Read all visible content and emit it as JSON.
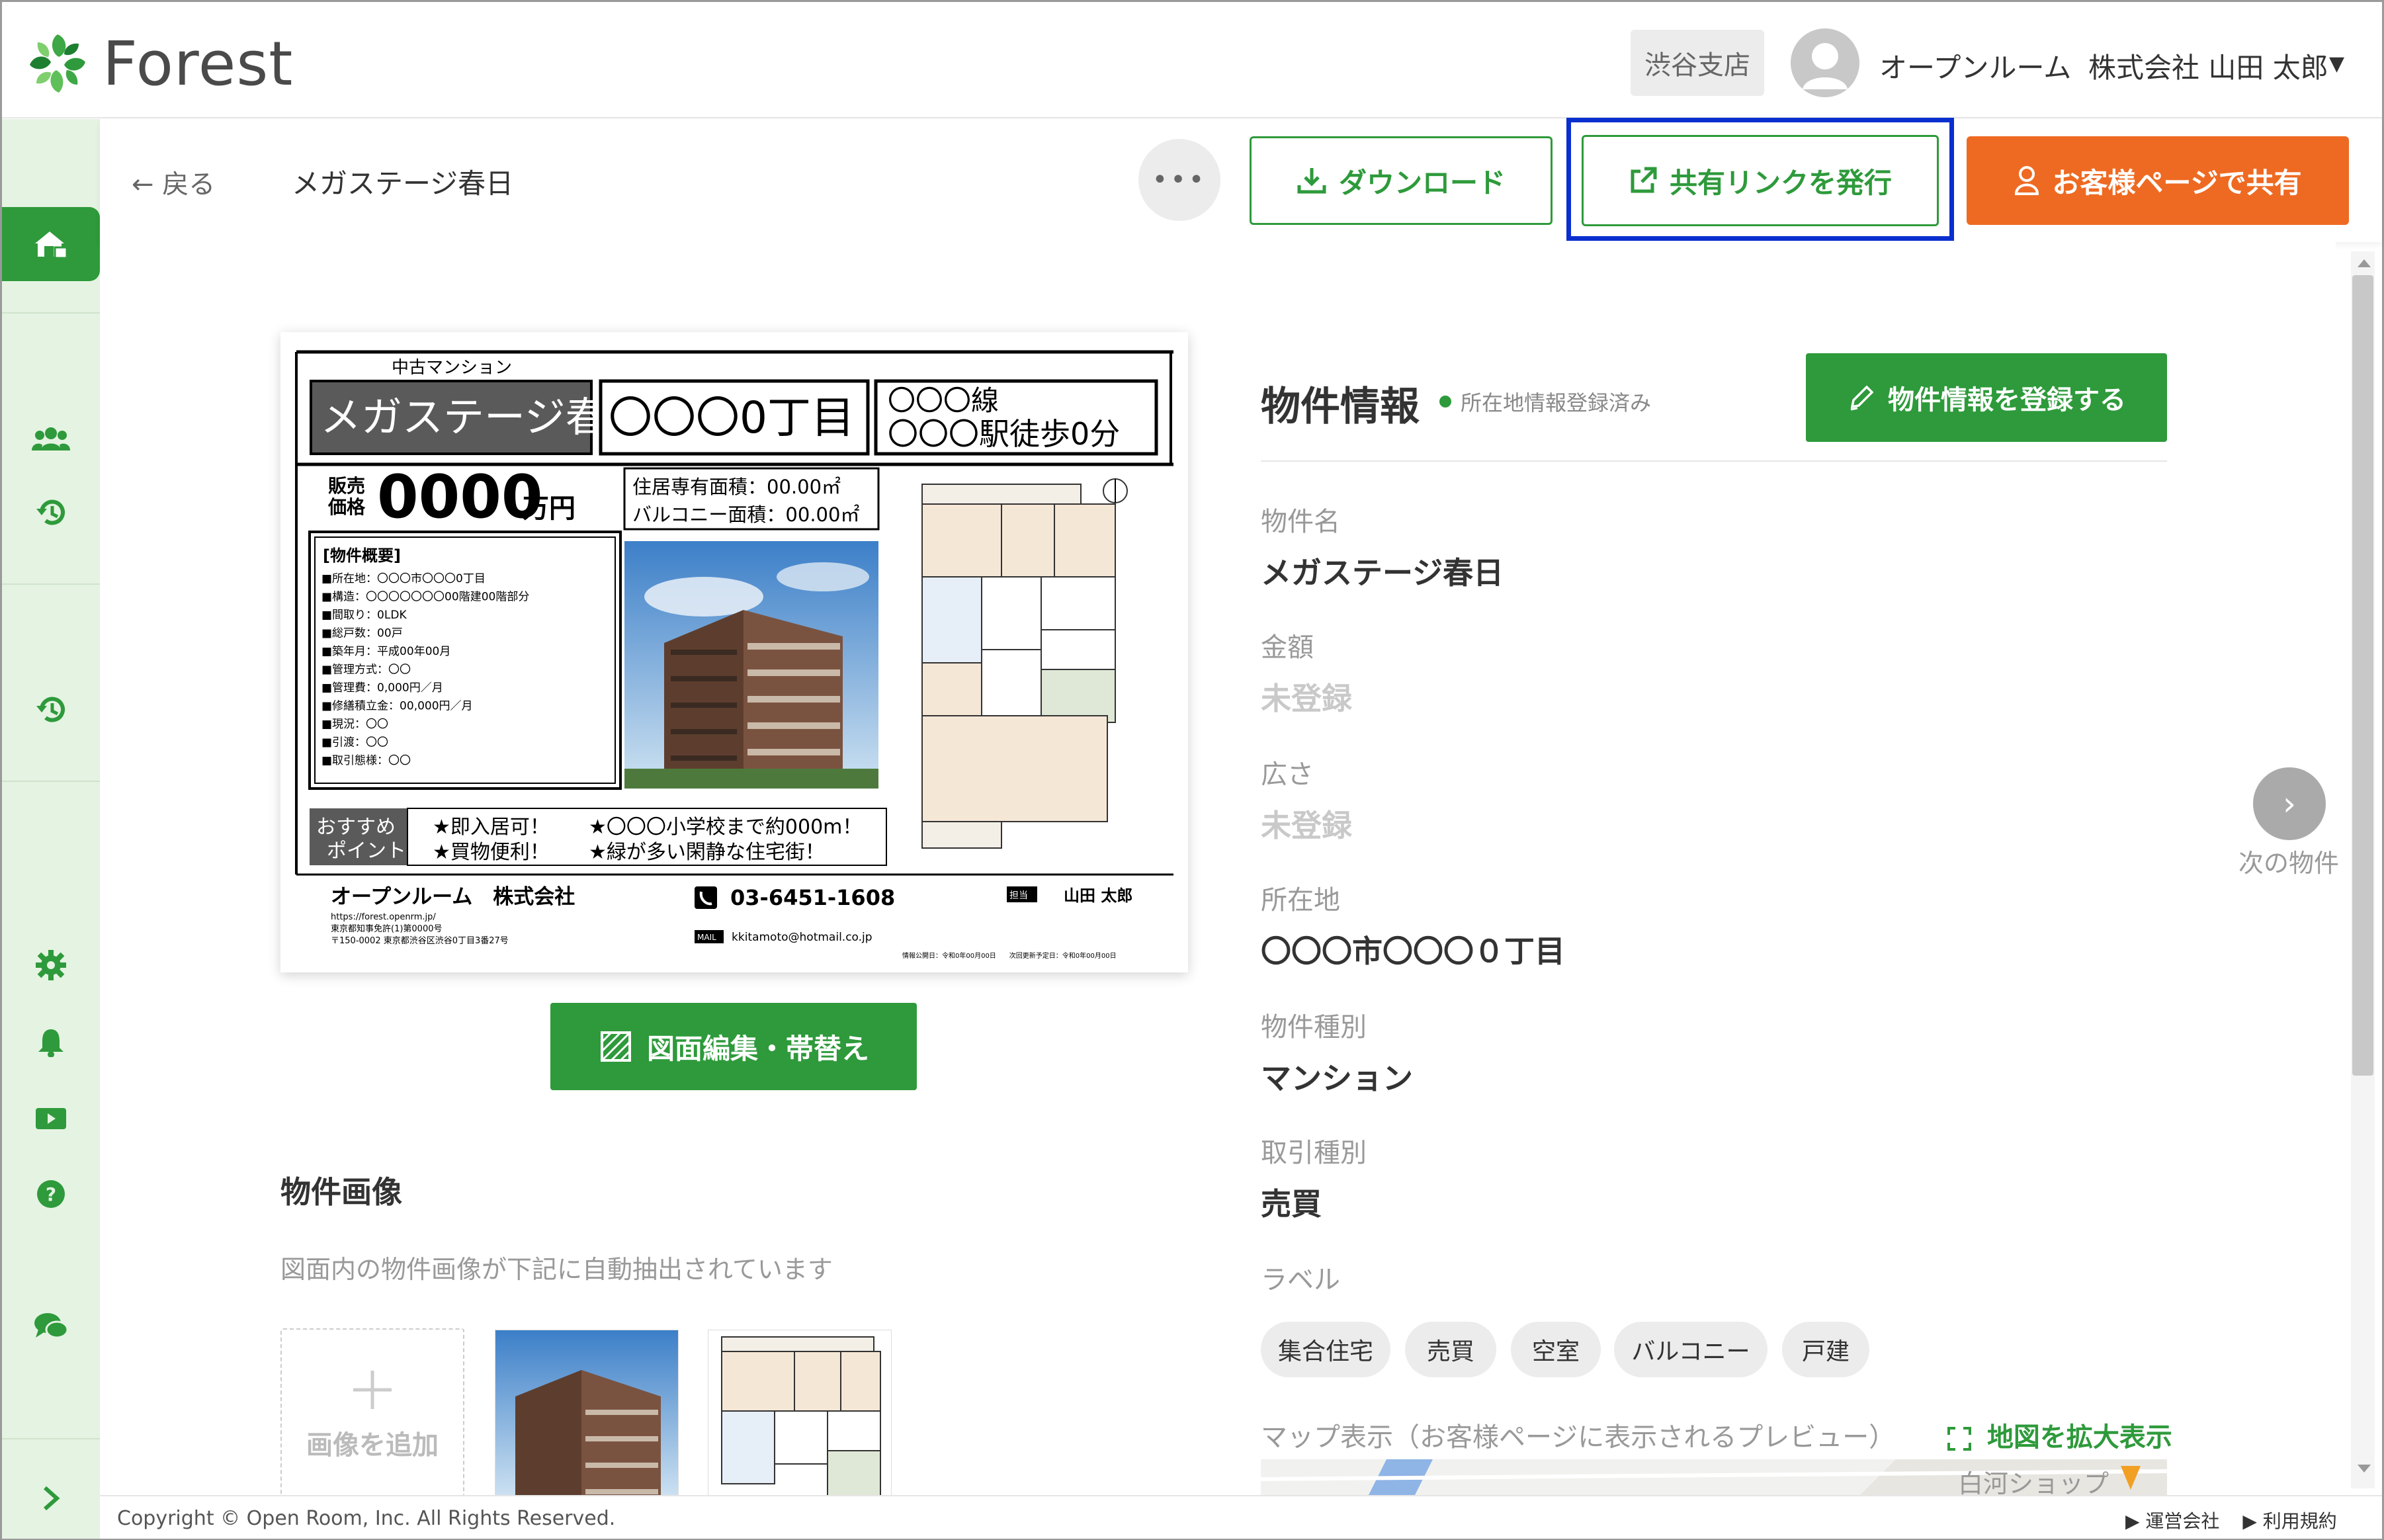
{
  "app": {
    "logo_text": "Forest",
    "brand_color": "#2e9a3b",
    "accent_color": "#ee6a22",
    "highlight_color": "#0a2fcf"
  },
  "header": {
    "branch": "渋谷支店",
    "company": "オープンルーム",
    "user": "株式会社 山田 太郎",
    "caret": "▼"
  },
  "toolbar": {
    "back": "← 戻る",
    "title": "メガステージ春日",
    "more": "•••",
    "download": "ダウンロード",
    "share_link": "共有リンクを発行",
    "customer_page": "お客様ページで共有"
  },
  "sidebar": {
    "items": [
      "home-icon",
      "users-icon",
      "history-icon",
      "history-icon-2",
      "settings-icon",
      "bell-icon",
      "video-icon",
      "help-icon",
      "chat-icon",
      "expand-icon"
    ]
  },
  "flyer": {
    "category": "中古マンション",
    "name": "メガステージ春日",
    "address": "〇〇〇0丁目",
    "line1": "〇〇〇線",
    "line2": "〇〇〇駅徒歩0分",
    "price_label1": "販売",
    "price_label2": "価格",
    "price": "0000",
    "price_unit": "万円",
    "area1": "住居専有面積：00.00㎡",
    "area2": "バルコニー面積：00.00㎡",
    "summary_title": "[物件概要]",
    "summary": [
      "■所在地：〇〇〇市〇〇〇0丁目",
      "■構造：〇〇〇〇〇〇〇00階建00階部分",
      "■間取り：0LDK",
      "■総戸数：00戸",
      "■築年月：平成00年00月",
      "■管理方式：〇〇",
      "■管理費：0,000円／月",
      "■修繕積立金：00,000円／月",
      "■現況：〇〇",
      "■引渡：〇〇",
      "■取引態様：〇〇"
    ],
    "rec_label1": "おすすめ",
    "rec_label2": "ポイント",
    "rec1": "★即入居可！",
    "rec2": "★買物便利！",
    "rec3": "★〇〇〇小学校まで約000m！",
    "rec4": "★緑が多い閑静な住宅街！",
    "agency": "オープンルーム　株式会社",
    "agency_url": "https://forest.openrm.jp/",
    "agency_license": "東京都知事免許(1)第0000号",
    "agency_address": "〒150-0002 東京都渋谷区渋谷0丁目3番27号",
    "phone": "03-6451-1608",
    "contact_label": "担当",
    "contact": "山田 太郎",
    "mail_label": "MAIL",
    "mail": "kkitamoto@hotmail.co.jp",
    "fine_print": "情報公開日：令和0年00月00日　　次回更新予定日：令和0年00月00日"
  },
  "edit_button": "図面編集・帯替え",
  "images": {
    "title": "物件画像",
    "subtitle": "図面内の物件画像が下記に自動抽出されています",
    "add": "画像を追加"
  },
  "info": {
    "title": "物件情報",
    "badge": "所在地情報登録済み",
    "register": "物件情報を登録する",
    "fields": [
      {
        "label": "物件名",
        "value": "メガステージ春日"
      },
      {
        "label": "金額",
        "value": "未登録"
      },
      {
        "label": "広さ",
        "value": "未登録"
      },
      {
        "label": "所在地",
        "value": "〇〇〇市〇〇〇０丁目"
      },
      {
        "label": "物件種別",
        "value": "マンション"
      },
      {
        "label": "取引種別",
        "value": "売買"
      }
    ],
    "label_title": "ラベル",
    "tags": [
      "集合住宅",
      "売買",
      "空室",
      "バルコニー",
      "戸建"
    ],
    "map_label": "マップ表示（お客様ページに表示されるプレビュー）",
    "map_zoom": "地図を拡大表示",
    "map_place": "白河ショップ"
  },
  "next": {
    "label": "次の物件",
    "arrow": "›"
  },
  "footer": {
    "copyright": "Copyright © Open Room, Inc. All Rights Reserved.",
    "link1": "▶ 運営会社",
    "link2": "▶ 利用規約"
  }
}
